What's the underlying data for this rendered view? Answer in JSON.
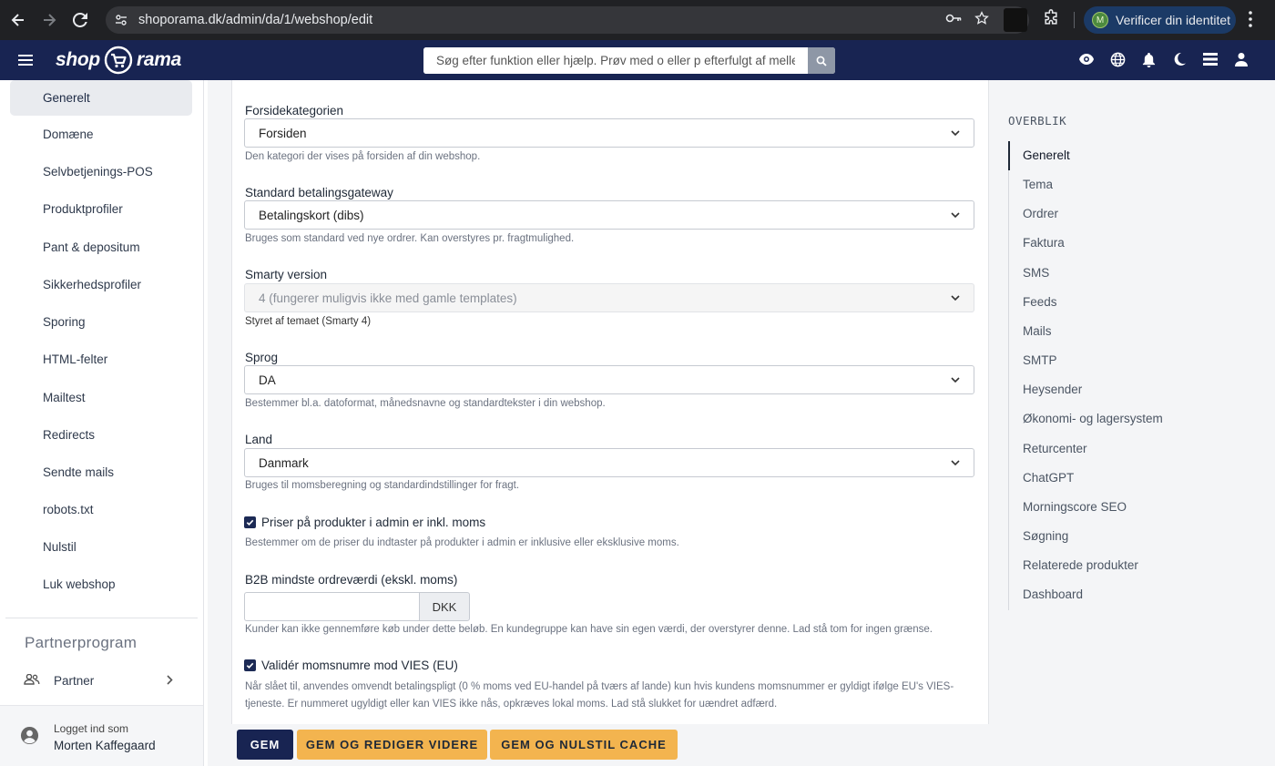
{
  "browser": {
    "url": "shoporama.dk/admin/da/1/webshop/edit",
    "verify_badge": "M",
    "verify_label": "Verificer din identitet"
  },
  "header": {
    "logo_left": "shop",
    "logo_right": "rama",
    "search_placeholder": "Søg efter funktion eller hjælp. Prøv med o eller p efterfulgt af mellemrum"
  },
  "sidebar": {
    "items": [
      {
        "label": "Generelt",
        "active": true
      },
      {
        "label": "Domæne"
      },
      {
        "label": "Selvbetjenings-POS"
      },
      {
        "label": "Produktprofiler"
      },
      {
        "label": "Pant & depositum"
      },
      {
        "label": "Sikkerhedsprofiler"
      },
      {
        "label": "Sporing"
      },
      {
        "label": "HTML-felter"
      },
      {
        "label": "Mailtest"
      },
      {
        "label": "Redirects"
      },
      {
        "label": "Sendte mails"
      },
      {
        "label": "robots.txt"
      },
      {
        "label": "Nulstil"
      },
      {
        "label": "Luk webshop"
      }
    ],
    "partner_title": "Partnerprogram",
    "partner_item": "Partner",
    "user_caption": "Logget ind som",
    "user_name": "Morten Kaffegaard"
  },
  "form": {
    "front_category": {
      "label": "Forsidekategorien",
      "value": "Forsiden",
      "help": "Den kategori der vises på forsiden af din webshop."
    },
    "payment_gateway": {
      "label": "Standard betalingsgateway",
      "value": "Betalingskort (dibs)",
      "help": "Bruges som standard ved nye ordrer. Kan overstyres pr. fragtmulighed."
    },
    "smarty": {
      "label": "Smarty version",
      "value": "4 (fungerer muligvis ikke med gamle templates)",
      "help": "Styret af temaet (Smarty 4)"
    },
    "language": {
      "label": "Sprog",
      "value": "DA",
      "help": "Bestemmer bl.a. datoformat, månedsnavne og standardtekster i din webshop."
    },
    "country": {
      "label": "Land",
      "value": "Danmark",
      "help": "Bruges til momsberegning og standardindstillinger for fragt."
    },
    "prices_incl_vat": {
      "label": "Priser på produkter i admin er inkl. moms",
      "checked": true,
      "help": "Bestemmer om de priser du indtaster på produkter i admin er inklusive eller eksklusive moms."
    },
    "b2b_min": {
      "label": "B2B mindste ordreværdi (ekskl. moms)",
      "value": "",
      "addon": "DKK",
      "help": "Kunder kan ikke gennemføre køb under dette beløb. En kundegruppe kan have sin egen værdi, der overstyrer denne. Lad stå tom for ingen grænse."
    },
    "vies": {
      "label": "Validér momsnumre mod VIES (EU)",
      "checked": true,
      "help": "Når slået til, anvendes omvendt betalingspligt (0 % moms ved EU-handel på tværs af lande) kun hvis kundens momsnummer er gyldigt ifølge EU's VIES-tjeneste. Er nummeret ugyldigt eller kan VIES ikke nås, opkræves lokal moms. Lad stå slukket for uændret adfærd."
    }
  },
  "actions": {
    "save": "GEM",
    "save_continue": "GEM OG REDIGER VIDERE",
    "save_clear_cache": "GEM OG NULSTIL CACHE"
  },
  "overview": {
    "title": "OVERBLIK",
    "items": [
      {
        "label": "Generelt",
        "active": true
      },
      {
        "label": "Tema"
      },
      {
        "label": "Ordrer"
      },
      {
        "label": "Faktura"
      },
      {
        "label": "SMS"
      },
      {
        "label": "Feeds"
      },
      {
        "label": "Mails"
      },
      {
        "label": "SMTP"
      },
      {
        "label": "Heysender"
      },
      {
        "label": "Økonomi- og lagersystem"
      },
      {
        "label": "Returcenter"
      },
      {
        "label": "ChatGPT"
      },
      {
        "label": "Morningscore SEO"
      },
      {
        "label": "Søgning"
      },
      {
        "label": "Relaterede produkter"
      },
      {
        "label": "Dashboard"
      }
    ]
  },
  "colors": {
    "header_bg": "#182452",
    "primary_button": "#182452",
    "warning_button": "#f3b44f",
    "browser_bg": "#202124"
  }
}
